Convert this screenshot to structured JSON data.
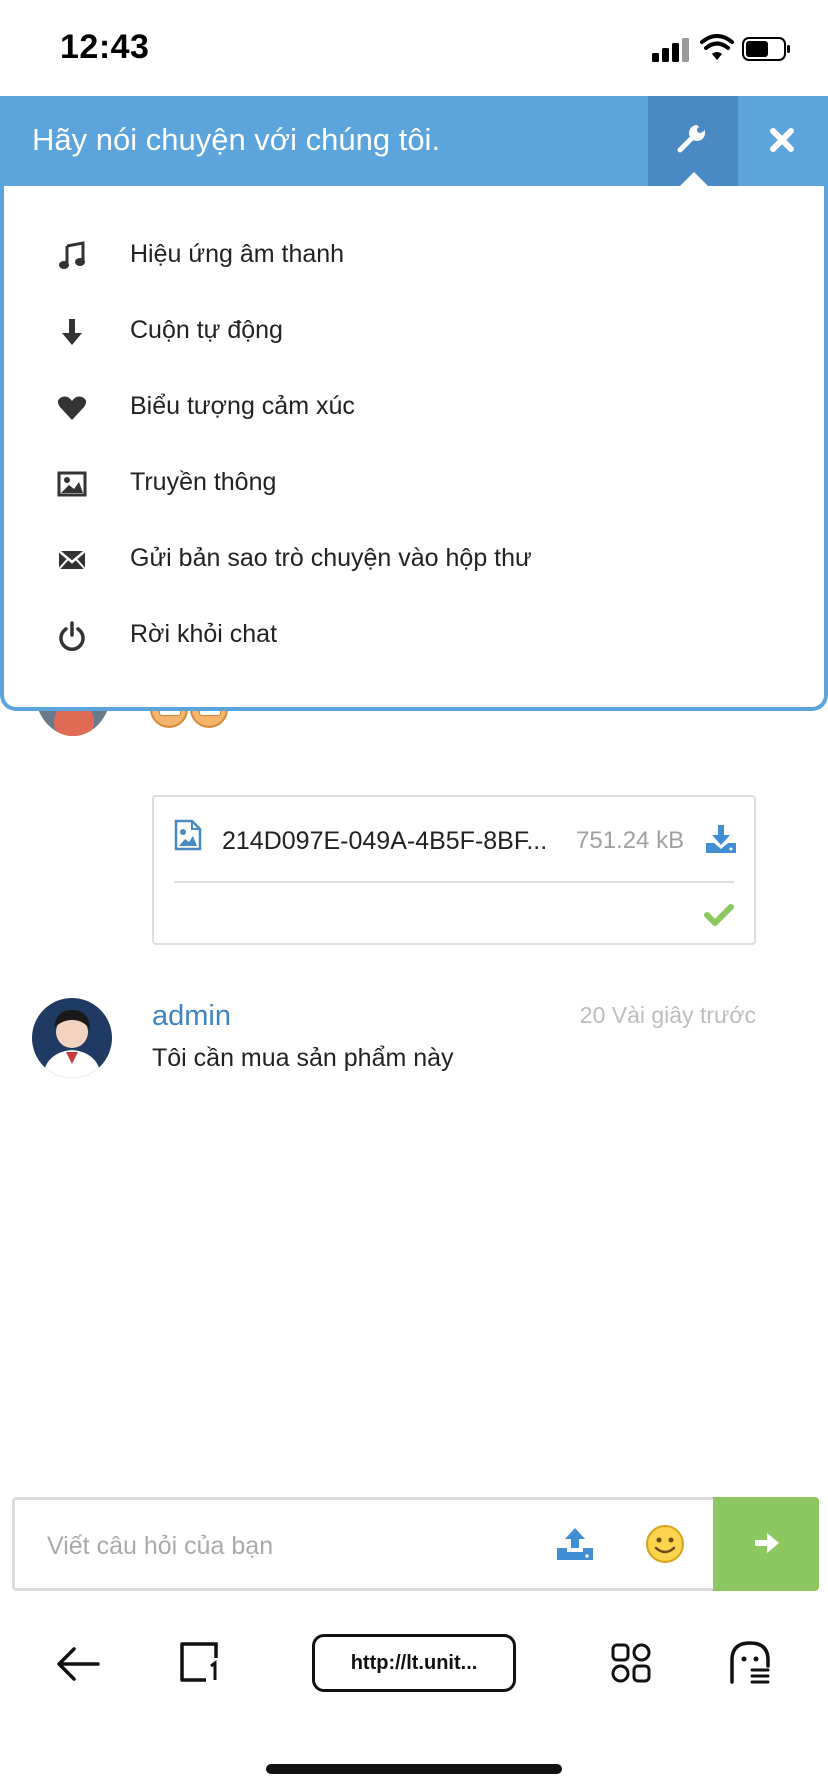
{
  "status_bar": {
    "time": "12:43"
  },
  "chat_header": {
    "title": "Hãy nói chuyện với chúng tôi."
  },
  "settings_menu": {
    "items": [
      {
        "label": "Hiệu ứng âm thanh",
        "icon": "music-note-icon"
      },
      {
        "label": "Cuộn tự động",
        "icon": "arrow-down-icon"
      },
      {
        "label": "Biểu tượng cảm xúc",
        "icon": "heart-icon"
      },
      {
        "label": "Truyền thông",
        "icon": "image-icon"
      },
      {
        "label": "Gửi bản sao trò chuyện vào hộp thư",
        "icon": "envelope-icon"
      },
      {
        "label": "Rời khỏi chat",
        "icon": "power-icon"
      }
    ]
  },
  "messages": {
    "file": {
      "name": "214D097E-049A-4B5F-8BF...",
      "size": "751.24 kB",
      "status": "sent"
    },
    "admin_message": {
      "author": "admin",
      "time": "20 Vài giây trước",
      "text": "Tôi cần mua sản phẩm này"
    }
  },
  "composer": {
    "placeholder": "Viết câu hỏi của bạn"
  },
  "browser": {
    "url": "http://lt.unit..."
  },
  "colors": {
    "header_blue": "#5ba4dc",
    "settings_active": "#4a8ac4",
    "author_blue": "#3f84c4",
    "send_green": "#8cc760",
    "check_green": "#8cc760"
  }
}
